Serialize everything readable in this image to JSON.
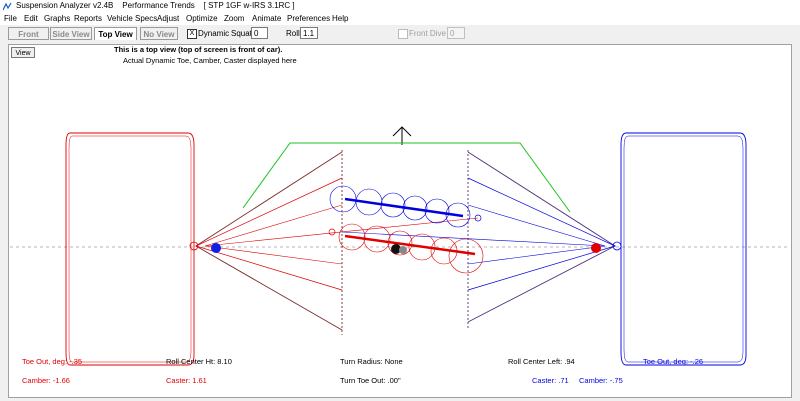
{
  "window": {
    "title": "Suspension Analyzer v2.4B    Performance Trends    [ STP 1GF w-IRS 3.1RC ]"
  },
  "menu": [
    "File",
    "Edit",
    "Graphs",
    "Reports",
    "Vehicle Specs",
    "Adjust",
    "Optimize",
    "Zoom",
    "Animate",
    "Preferences",
    "Help"
  ],
  "toolbar": {
    "tabs": [
      "Front View",
      "Side View",
      "Top View",
      "No View"
    ],
    "active_tab": "Top View",
    "dynamic_checked": "X",
    "dynamic_label": "Dynamic",
    "squat_label": "Squat",
    "squat_value": "0",
    "roll_label": "Roll",
    "roll_value": "1.1",
    "front_dive_label": "Front Dive",
    "front_dive_value": "0"
  },
  "view": {
    "view_button": "View",
    "info_line1": "This is a top view (top of screen is front of car).",
    "info_line2": "Actual Dynamic Toe, Camber, Caster displayed here"
  },
  "readouts": {
    "toe_left": "Toe Out, deg: -.35",
    "camber_left": "Camber: -1.66",
    "caster_left": "Caster: 1.61",
    "roll_center_ht": "Roll Center Ht: 8.10",
    "turn_radius": "Turn Radius: None",
    "turn_toe_out": "Turn Toe Out: .00\"",
    "roll_center_left": "Roll Center Left: .94",
    "caster_right": "Caster: .71",
    "camber_right": "Camber: -.75",
    "toe_right": "Toe Out, deg: -.26"
  },
  "colors": {
    "left_side": "#e00000",
    "right_side": "#0000e0",
    "chassis_outline": "#20c020",
    "centerline": "#a0a0a0",
    "link_dark": "#7a2a2a"
  }
}
